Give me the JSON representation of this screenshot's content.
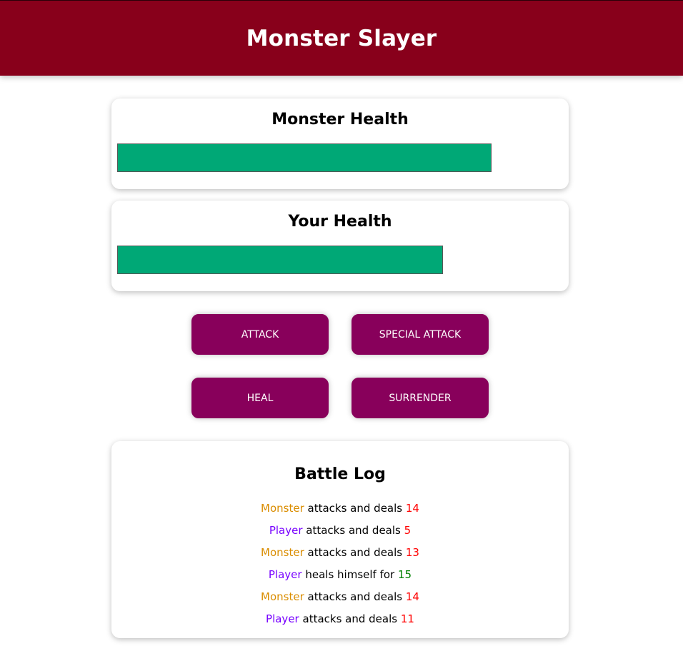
{
  "header": {
    "title": "Monster Slayer"
  },
  "monster": {
    "heading": "Monster Health",
    "health": 84
  },
  "player": {
    "heading": "Your Health",
    "health": 73
  },
  "controls": {
    "attack_label": "ATTACK",
    "special_label": "SPECIAL ATTACK",
    "heal_label": "HEAL",
    "surrender_label": "SURRENDER"
  },
  "battle_log": {
    "heading": "Battle Log",
    "entries": [
      {
        "actor": "Monster",
        "action": "attacks and deals",
        "value": "14",
        "kind": "damage"
      },
      {
        "actor": "Player",
        "action": "attacks and deals",
        "value": "5",
        "kind": "damage"
      },
      {
        "actor": "Monster",
        "action": "attacks and deals",
        "value": "13",
        "kind": "damage"
      },
      {
        "actor": "Player",
        "action": "heals himself for",
        "value": "15",
        "kind": "heal"
      },
      {
        "actor": "Monster",
        "action": "attacks and deals",
        "value": "14",
        "kind": "damage"
      },
      {
        "actor": "Player",
        "action": "attacks and deals",
        "value": "11",
        "kind": "damage"
      }
    ]
  },
  "colors": {
    "header": "#88001b",
    "button": "#88005b",
    "health_bar": "#00a876",
    "player_name": "#7700ff",
    "monster_name": "#da8d00",
    "damage": "#ff0000",
    "heal": "#008000"
  }
}
